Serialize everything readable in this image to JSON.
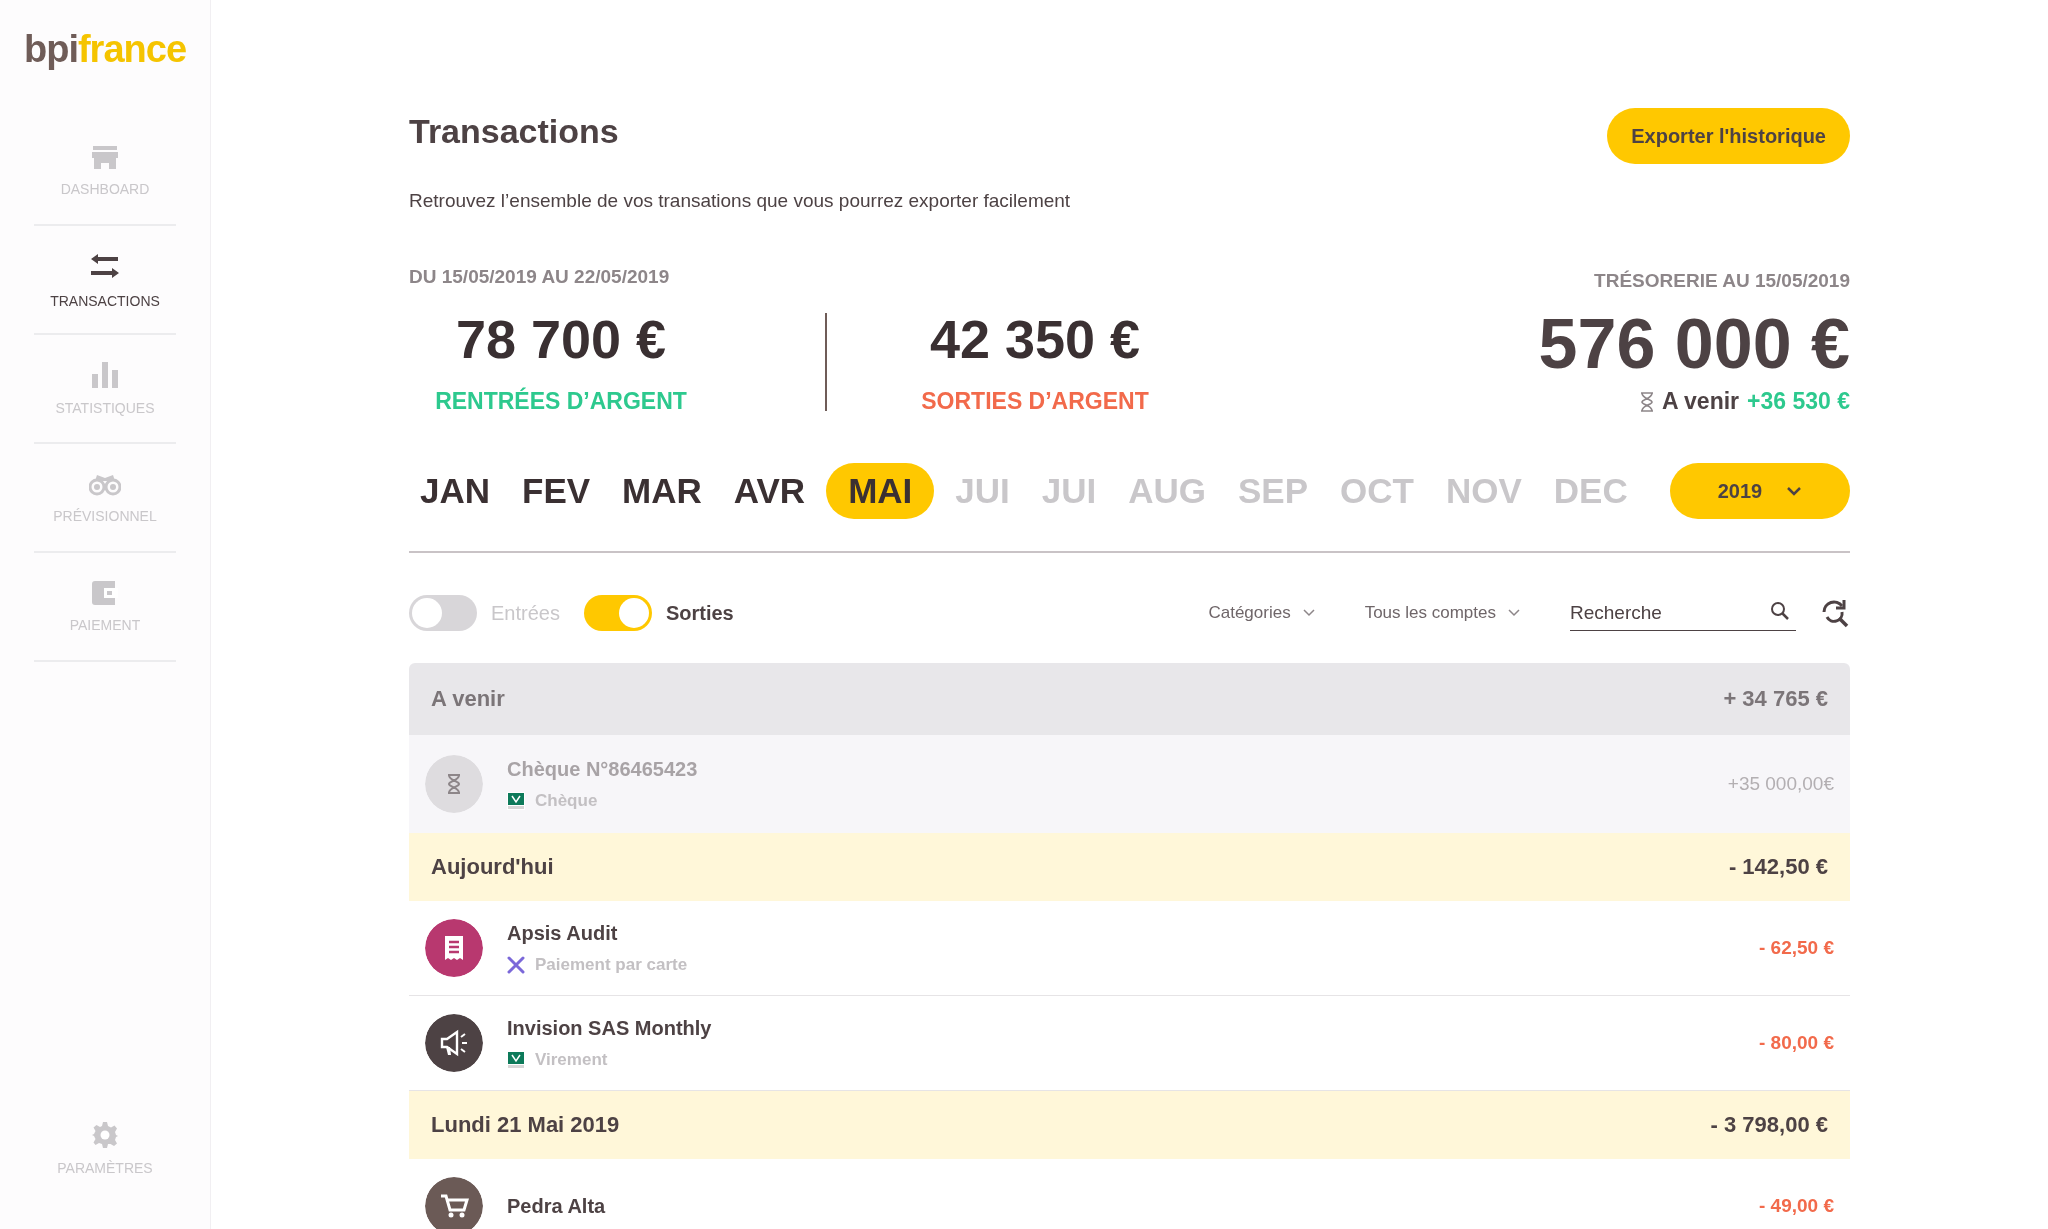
{
  "sidebar": {
    "logo": {
      "part_1": "bpi",
      "part_2": "france"
    },
    "items": [
      {
        "label": "DASHBOARD",
        "kind": "shop",
        "selected": false
      },
      {
        "label": "TRANSACTIONS",
        "kind": "arrows",
        "selected": true
      },
      {
        "label": "STATISTIQUES",
        "kind": "bars",
        "selected": false
      },
      {
        "label": "PRÉVISIONNEL",
        "kind": "binoculars",
        "selected": false
      },
      {
        "label": "PAIEMENT",
        "kind": "wallet",
        "selected": false
      }
    ],
    "footer_item": {
      "label": "PARAMÈTRES",
      "kind": "gear",
      "selected": false
    }
  },
  "header": {
    "title": "Transactions",
    "subtitle": "Retrouvez l’ensemble de vos transations que vous pourrez exporter facilement",
    "export_button": "Exporter l'historique"
  },
  "summary": {
    "period": "DU 15/05/2019 AU 22/05/2019",
    "income": {
      "amount": "78 700 €",
      "label": "RENTRÉES D’ARGENT"
    },
    "expenses": {
      "amount": "42 350 €",
      "label": "SORTIES D’ARGENT"
    },
    "treasury": {
      "label": "TRÉSORERIE AU 15/05/2019",
      "amount": "576 000 €",
      "upcoming_label": "A venir",
      "upcoming_amount": "+36 530 €"
    }
  },
  "months": [
    {
      "label": "JAN",
      "selected": false,
      "disabled": false
    },
    {
      "label": "FEV",
      "selected": false,
      "disabled": false
    },
    {
      "label": "MAR",
      "selected": false,
      "disabled": false
    },
    {
      "label": "AVR",
      "selected": false,
      "disabled": false
    },
    {
      "label": "MAI",
      "selected": true,
      "disabled": false
    },
    {
      "label": "JUI",
      "selected": false,
      "disabled": true
    },
    {
      "label": "JUI",
      "selected": false,
      "disabled": true
    },
    {
      "label": "AUG",
      "selected": false,
      "disabled": true
    },
    {
      "label": "SEP",
      "selected": false,
      "disabled": true
    },
    {
      "label": "OCT",
      "selected": false,
      "disabled": true
    },
    {
      "label": "NOV",
      "selected": false,
      "disabled": true
    },
    {
      "label": "DEC",
      "selected": false,
      "disabled": true
    }
  ],
  "year_select": {
    "value": "2019"
  },
  "filters": {
    "toggles": [
      {
        "label": "Entrées",
        "on": false
      },
      {
        "label": "Sorties",
        "on": true
      }
    ],
    "categories": "Catégories",
    "accounts": "Tous les comptes",
    "search": {
      "placeholder": "Recherche"
    }
  },
  "groups": [
    {
      "kind": "upcoming",
      "title": "A venir",
      "total": "+ 34 765 €",
      "rows": [
        {
          "name": "Chèque N°86465423",
          "method": {
            "label": "Chèque",
            "kind": "bank"
          },
          "kind": "hourglass",
          "pending": true,
          "amount": "+35 000,00€"
        }
      ]
    },
    {
      "kind": "day",
      "title": "Aujourd'hui",
      "total": "- 142,50 €",
      "rows": [
        {
          "name": "Apsis Audit",
          "method": {
            "label": "Paiement par carte",
            "kind": "card"
          },
          "kind": "receipt",
          "color": "#b8386f",
          "pending": false,
          "amount": "- 62,50 €"
        },
        {
          "name": "Invision SAS Monthly",
          "method": {
            "label": "Virement",
            "kind": "bank"
          },
          "kind": "megaphone",
          "color": "#4d4244",
          "pending": false,
          "amount": "- 80,00 €"
        }
      ]
    },
    {
      "kind": "day",
      "title": "Lundi 21 Mai 2019",
      "total": "- 3 798,00 €",
      "rows": [
        {
          "name": "Pedra Alta",
          "kind": "cart",
          "color": "#6b5a56",
          "pending": false,
          "amount": "- 49,00 €"
        }
      ]
    }
  ]
}
